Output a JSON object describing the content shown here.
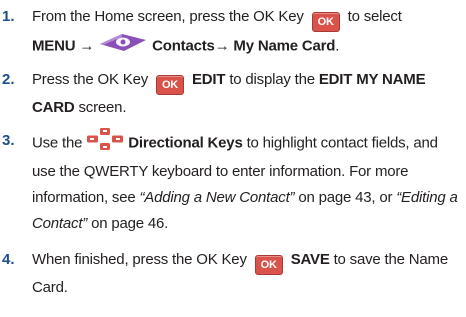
{
  "ok_key_label": "OK",
  "steps": [
    {
      "number": "1.",
      "line1_a": "From the Home screen, press the OK Key",
      "line1_b": "to select",
      "menu": "MENU",
      "arrow": "→",
      "contacts": "Contacts→ My Name Card",
      "period": "."
    },
    {
      "number": "2.",
      "text_a": "Press the OK Key",
      "edit": "EDIT",
      "text_b": "to display the",
      "screen_name": "EDIT MY NAME CARD",
      "text_c": "screen."
    },
    {
      "number": "3.",
      "text_a": "Use the",
      "dir_keys": "Directional Keys",
      "text_b": "to highlight contact fields, and use the QWERTY keyboard to enter information. For more information, see",
      "ref1": "“Adding a New Contact”",
      "text_c": "on page 43, or",
      "ref2": "“Editing a Contact”",
      "text_d": "on page 46."
    },
    {
      "number": "4.",
      "text_a": "When finished, press the OK Key",
      "save": "SAVE",
      "text_b": "to save the Name Card."
    }
  ]
}
